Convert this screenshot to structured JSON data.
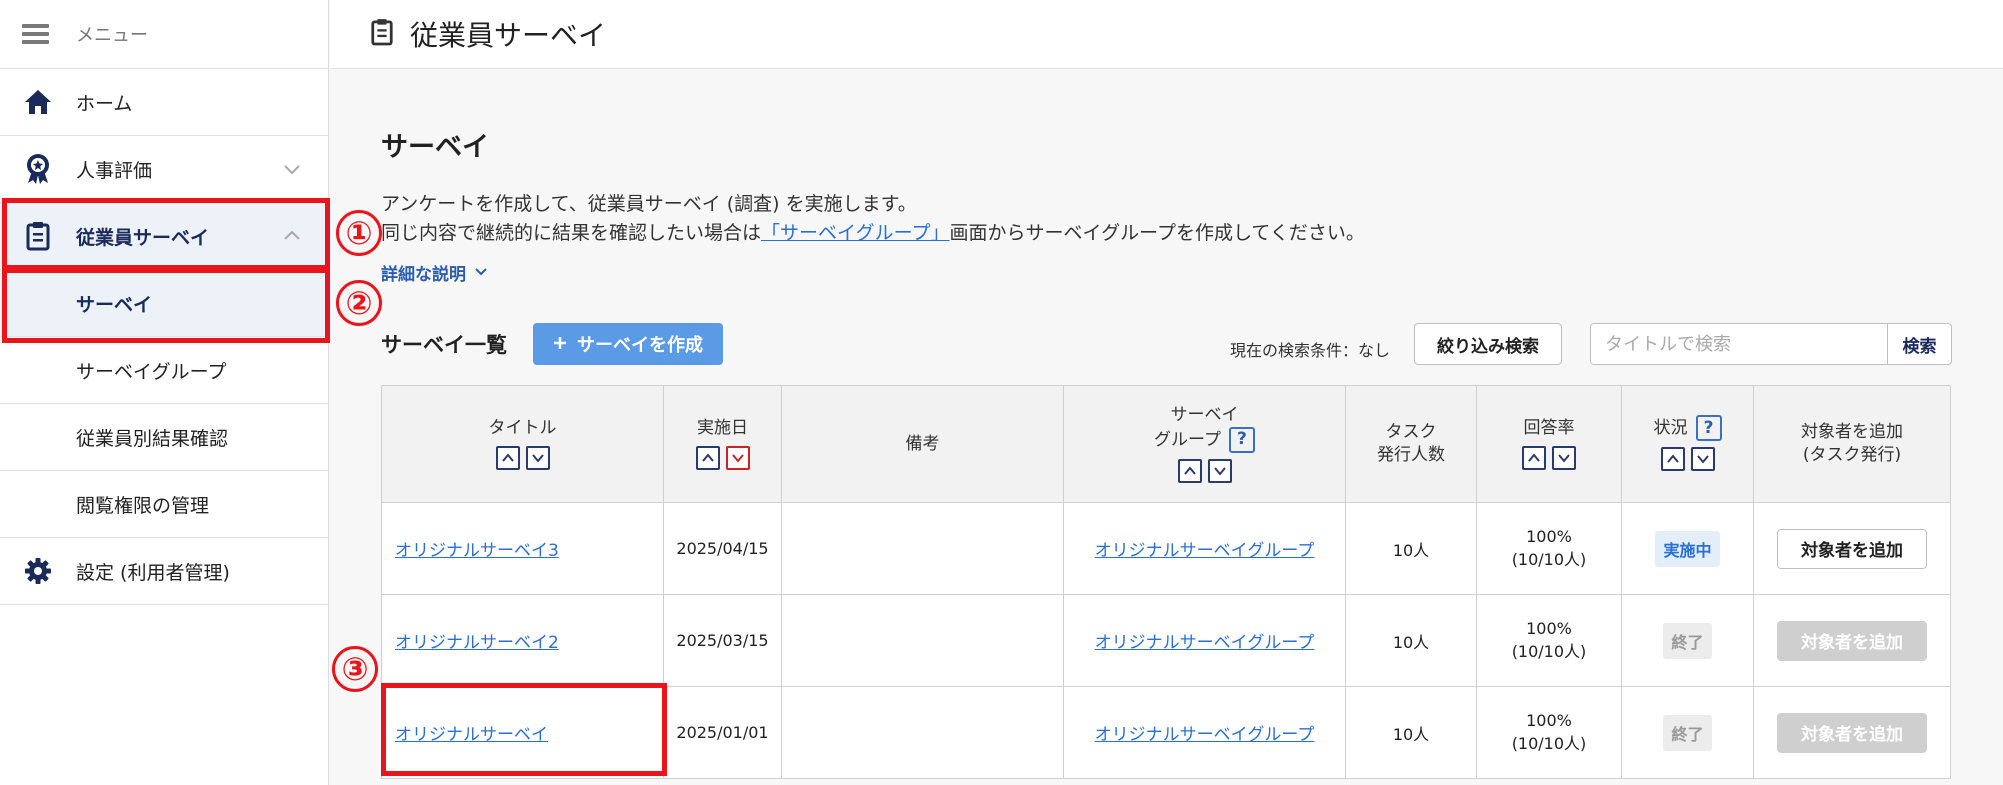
{
  "sidebar": {
    "menu_label": "メニュー",
    "items": [
      {
        "label": "ホーム",
        "icon": "home-icon"
      },
      {
        "label": "人事評価",
        "icon": "award-icon"
      },
      {
        "label": "従業員サーベイ",
        "icon": "clipboard-icon"
      }
    ],
    "sub_items": [
      {
        "label": "サーベイ"
      },
      {
        "label": "サーベイグループ"
      },
      {
        "label": "従業員別結果確認"
      },
      {
        "label": "閲覧権限の管理"
      }
    ],
    "settings": {
      "label": "設定 (利用者管理)",
      "icon": "gear-icon"
    }
  },
  "header": {
    "title": "従業員サーベイ"
  },
  "annotations": {
    "n1": "①",
    "n2": "②",
    "n3": "③",
    "color": "#e8151c"
  },
  "main": {
    "heading": "サーベイ",
    "desc_line1": "アンケートを作成して、従業員サーベイ (調査) を実施します。",
    "desc_line2_pre": "同じ内容で継続的に結果を確認したい場合は",
    "desc_line2_link": "「サーベイグループ」",
    "desc_line2_post": "画面からサーベイグループを作成してください。",
    "detail_link": "詳細な説明",
    "list_title": "サーベイ一覧",
    "create_button": "サーベイを作成",
    "search_condition": "現在の検索条件：なし",
    "filter_button": "絞り込み検索",
    "search_placeholder": "タイトルで検索",
    "search_button": "検索"
  },
  "table": {
    "headers": {
      "title": "タイトル",
      "date": "実施日",
      "note": "備考",
      "group_line1": "サーベイ",
      "group_line2": "グループ",
      "tasks_line1": "タスク",
      "tasks_line2": "発行人数",
      "rate": "回答率",
      "status": "状況",
      "add_line1": "対象者を追加",
      "add_line2": "(タスク発行)"
    },
    "rows": [
      {
        "title": "オリジナルサーベイ3",
        "date": "2025/04/15",
        "note": "",
        "group": "オリジナルサーベイグループ",
        "tasks": "10人",
        "rate": "100%",
        "rate_detail": "(10/10人)",
        "status": "実施中",
        "add_button": "対象者を追加"
      },
      {
        "title": "オリジナルサーベイ2",
        "date": "2025/03/15",
        "note": "",
        "group": "オリジナルサーベイグループ",
        "tasks": "10人",
        "rate": "100%",
        "rate_detail": "(10/10人)",
        "status": "終了",
        "add_button": "対象者を追加"
      },
      {
        "title": "オリジナルサーベイ",
        "date": "2025/01/01",
        "note": "",
        "group": "オリジナルサーベイグループ",
        "tasks": "10人",
        "rate": "100%",
        "rate_detail": "(10/10人)",
        "status": "終了",
        "add_button": "対象者を追加"
      }
    ]
  }
}
